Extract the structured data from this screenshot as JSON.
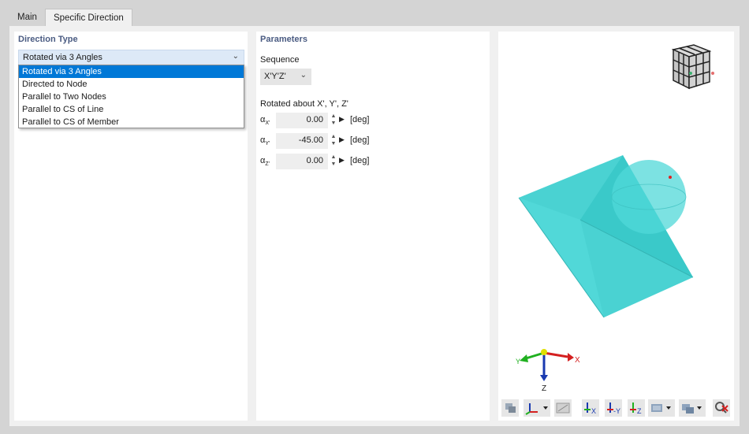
{
  "tabs": [
    {
      "label": "Main",
      "active": false
    },
    {
      "label": "Specific Direction",
      "active": true
    }
  ],
  "direction_type": {
    "title": "Direction Type",
    "selected": "Rotated via 3 Angles",
    "options": [
      "Rotated via 3 Angles",
      "Directed to Node",
      "Parallel to Two Nodes",
      "Parallel to CS of Line",
      "Parallel to CS of Member"
    ]
  },
  "parameters": {
    "title": "Parameters",
    "sequence_label": "Sequence",
    "sequence_value": "X'Y'Z'",
    "rotated_label": "Rotated about X', Y', Z'",
    "angles": [
      {
        "symbol": "α",
        "subscript": "X'",
        "value": "0.00",
        "unit": "[deg]"
      },
      {
        "symbol": "α",
        "subscript": "Y'",
        "value": "-45.00",
        "unit": "[deg]"
      },
      {
        "symbol": "α",
        "subscript": "Z'",
        "value": "0.00",
        "unit": "[deg]"
      }
    ]
  },
  "view": {
    "axis_labels": {
      "x": "X",
      "y": "Y",
      "z": "Z"
    },
    "colors": {
      "shape": "#40d0d0",
      "x_axis": "#d42020",
      "y_axis": "#20b020",
      "z_axis": "#1a3ab0",
      "point": "#e02020"
    },
    "toolbar_icons": [
      "render-mode-icon",
      "coordinate-system-icon",
      "view-options-icon",
      "view-x-icon",
      "view-minus-y-icon",
      "view-z-icon",
      "display-icon",
      "iso-view-icon",
      "reset-zoom-icon"
    ]
  }
}
